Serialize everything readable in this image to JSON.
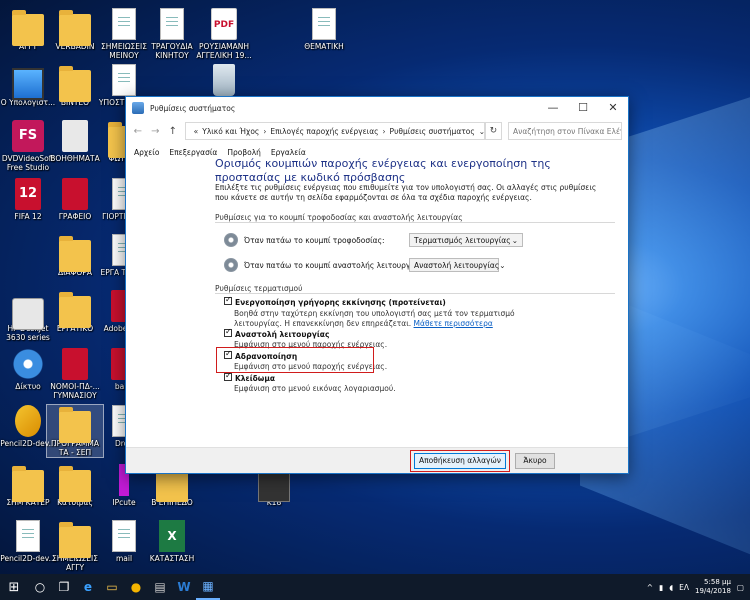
{
  "desktop": {
    "icons": [
      {
        "label": "ΑΓΓΥ"
      },
      {
        "label": "VERBADIN"
      },
      {
        "label": "ΣΗΜΕΙΩΣΕΙΣ ΜΕΙΝΟΥ"
      },
      {
        "label": "ΤΡΑΓΟΥΔΙΑ ΚΙΝΗΤΟΥ"
      },
      {
        "label": "ΡΟΥΣΙΑΜΑΝΗ ΑΓΓΕΛΙΚΗ 19..."
      },
      {
        "label": "ΘΕΜΑΤΙΚΗ"
      },
      {
        "label": "Ο Υπολογιστ..."
      },
      {
        "label": "ΒΙΝΤΕΟ"
      },
      {
        "label": "ΥΠΟΣΤΕΓ ΕΡΓ"
      },
      {
        "label": "DVDVideoSoft Free Studio"
      },
      {
        "label": "ΒΟΗΘΗΜΑΤΑ"
      },
      {
        "label": "ΦΩΤΟΓΡ"
      },
      {
        "label": "FIFA 12"
      },
      {
        "label": "ΓΡΑΦΕΙΟ"
      },
      {
        "label": "ΓΙΟΡΤΕ ΓΥΜ"
      },
      {
        "label": "ΔΙΑΦΟΡΑ"
      },
      {
        "label": "ΕΡΓΑ ΤΕΧΝΟ"
      },
      {
        "label": "HP DeskJet 3630 series"
      },
      {
        "label": "ΕΡΓΑΤΙΚΟ"
      },
      {
        "label": "Adobe Edit"
      },
      {
        "label": "Δίκτυο"
      },
      {
        "label": "ΝΟΜΟΙ-ΠΔ-... ΓΥΜΝΑΣΙΟΥ"
      },
      {
        "label": "balle"
      },
      {
        "label": "Pencil2D-dev..."
      },
      {
        "label": "ΠΡΟΓΡΑΜΜΑ ΤΑ - ΣΕΠ"
      },
      {
        "label": "Drop"
      },
      {
        "label": "ΣΗΜ ΚΑΤΕΡ"
      },
      {
        "label": "Κατσίρας"
      },
      {
        "label": "IPcute"
      },
      {
        "label": "Β ΕΠΙΠΕΔΟ"
      },
      {
        "label": "K18"
      },
      {
        "label": "Pencil2D-dev..."
      },
      {
        "label": "ΣΗΜΕΙΩΣΕΙΣ ΑΓΓΥ"
      },
      {
        "label": "mail"
      },
      {
        "label": "ΚΑΤΑΣΤΑΣΗ"
      }
    ]
  },
  "window": {
    "title": "Ρυθμίσεις συστήματος",
    "controls": {
      "minimize": "—",
      "maximize": "☐",
      "close": "✕"
    },
    "nav": {
      "back": "←",
      "forward": "→",
      "up": "↑",
      "refresh": "↻"
    },
    "address": {
      "prefix": "«",
      "crumbs": [
        "Υλικό και Ήχος",
        "Επιλογές παροχής ενέργειας",
        "Ρυθμίσεις συστήματος"
      ],
      "sep": "›",
      "dropdown": "⌄"
    },
    "search": {
      "placeholder": "Αναζήτηση στον Πίνακα Ελέγ...",
      "icon": "⌕"
    },
    "menu": [
      "Αρχείο",
      "Επεξεργασία",
      "Προβολή",
      "Εργαλεία"
    ],
    "heading": "Ορισμός κουμπιών παροχής ενέργειας και ενεργοποίηση της προστασίας με κωδικό πρόσβασης",
    "description": "Επιλέξτε τις ρυθμίσεις ενέργειας που επιθυμείτε για τον υπολογιστή σας. Οι αλλαγές στις ρυθμίσεις που κάνετε σε αυτήν τη σελίδα εφαρμόζονται σε όλα τα σχέδια παροχής ενέργειας.",
    "buttons_section": {
      "title": "Ρυθμίσεις για το κουμπί τροφοδοσίας και αναστολής λειτουργίας",
      "power": {
        "label": "Όταν πατάω το κουμπί τροφοδοσίας:",
        "value": "Τερματισμός λειτουργίας"
      },
      "sleep": {
        "label": "Όταν πατάω το κουμπί αναστολής λειτουργίας:",
        "value": "Αναστολή λειτουργίας"
      }
    },
    "shutdown_section": {
      "title": "Ρυθμίσεις τερματισμού",
      "options": [
        {
          "title": "Ενεργοποίηση γρήγορης εκκίνησης (προτείνεται)",
          "desc": "Βοηθά στην ταχύτερη εκκίνηση του υπολογιστή σας μετά τον τερματισμό λειτουργίας. Η επανεκκίνηση δεν επηρεάζεται.",
          "link": "Μάθετε περισσότερα",
          "checked": true
        },
        {
          "title": "Αναστολή λειτουργίας",
          "desc": "Εμφάνιση στο μενού παροχής ενέργειας.",
          "checked": true
        },
        {
          "title": "Αδρανοποίηση",
          "desc": "Εμφάνιση στο μενού παροχής ενέργειας.",
          "checked": true
        },
        {
          "title": "Κλείδωμα",
          "desc": "Εμφάνιση στο μενού εικόνας λογαριασμού.",
          "checked": true
        }
      ]
    },
    "save_button": "Αποθήκευση αλλαγών",
    "cancel_button": "Άκυρο",
    "highlight_color": "#d01c1c"
  },
  "taskbar": {
    "start": "⊞",
    "search": "○",
    "taskview": "❐",
    "apps": [
      "e",
      "▭",
      "●",
      "▤",
      "W",
      "▦"
    ],
    "tray": {
      "chevron": "^",
      "language": "EΛ",
      "time": "5:58 μμ",
      "date": "19/4/2018",
      "notifications": "▢"
    }
  }
}
